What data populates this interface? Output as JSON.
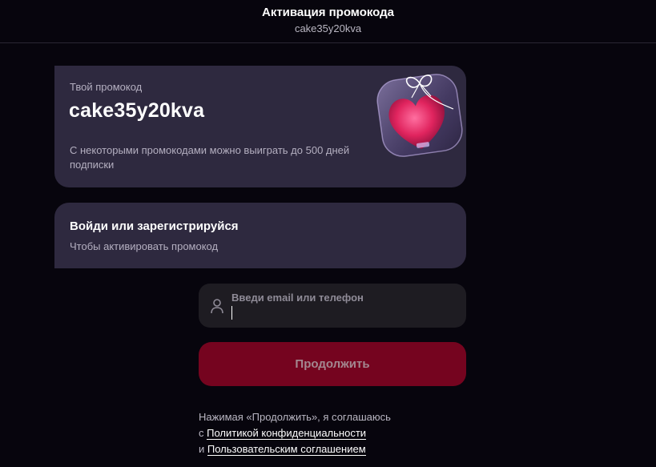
{
  "header": {
    "title": "Активация промокода",
    "subtitle": "cake35y20kva"
  },
  "promo_card": {
    "label": "Твой промокод",
    "code": "cake35y20kva",
    "description": "С некоторыми промокодами можно выиграть до 500 дней подписки",
    "image_icon": "gift-box-heart-icon"
  },
  "login_card": {
    "title": "Войди или зарегистрируйся",
    "subtitle": "Чтобы активировать промокод"
  },
  "login_form": {
    "input_label": "Введи email или телефон",
    "input_value": "",
    "input_icon": "user-icon",
    "continue_label": "Продолжить"
  },
  "terms": {
    "line1": "Нажимая «Продолжить», я соглашаюсь",
    "prefix2": "с ",
    "privacy_link": "Политикой конфиденциальности",
    "prefix3": "и ",
    "agreement_link": "Пользовательским соглашением"
  },
  "colors": {
    "background": "#07050d",
    "card": "#2e293f",
    "input": "#1e1c22",
    "accent_button": "#75041f"
  }
}
